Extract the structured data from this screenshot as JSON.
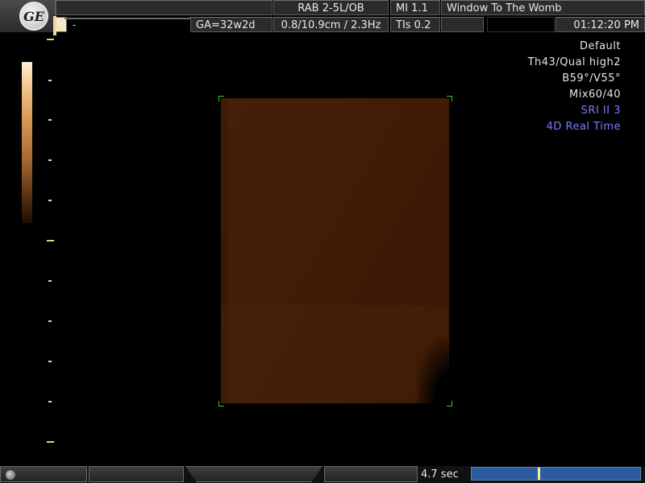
{
  "header": {
    "logo_text": "GE",
    "probe_preset": "RAB 2-5L/OB",
    "mi": "MI  1.1",
    "title": "Window To The Womb",
    "ga": "GA=32w2d",
    "depth_freq": "0.8/10.9cm / 2.3Hz",
    "tis": "TIs  0.2",
    "dash": "-",
    "time": "01:12:20 PM"
  },
  "info": {
    "lines": [
      "Default",
      "Th43/Qual high2",
      "B59°/V55°",
      "Mix60/40"
    ],
    "sri": "SRI II 3",
    "mode": "4D Real Time",
    "mode_color": "#7a7cff"
  },
  "bottom": {
    "duration": "4.7 sec",
    "cine_position": 0.39,
    "cine_color": "#2a5c9e"
  }
}
